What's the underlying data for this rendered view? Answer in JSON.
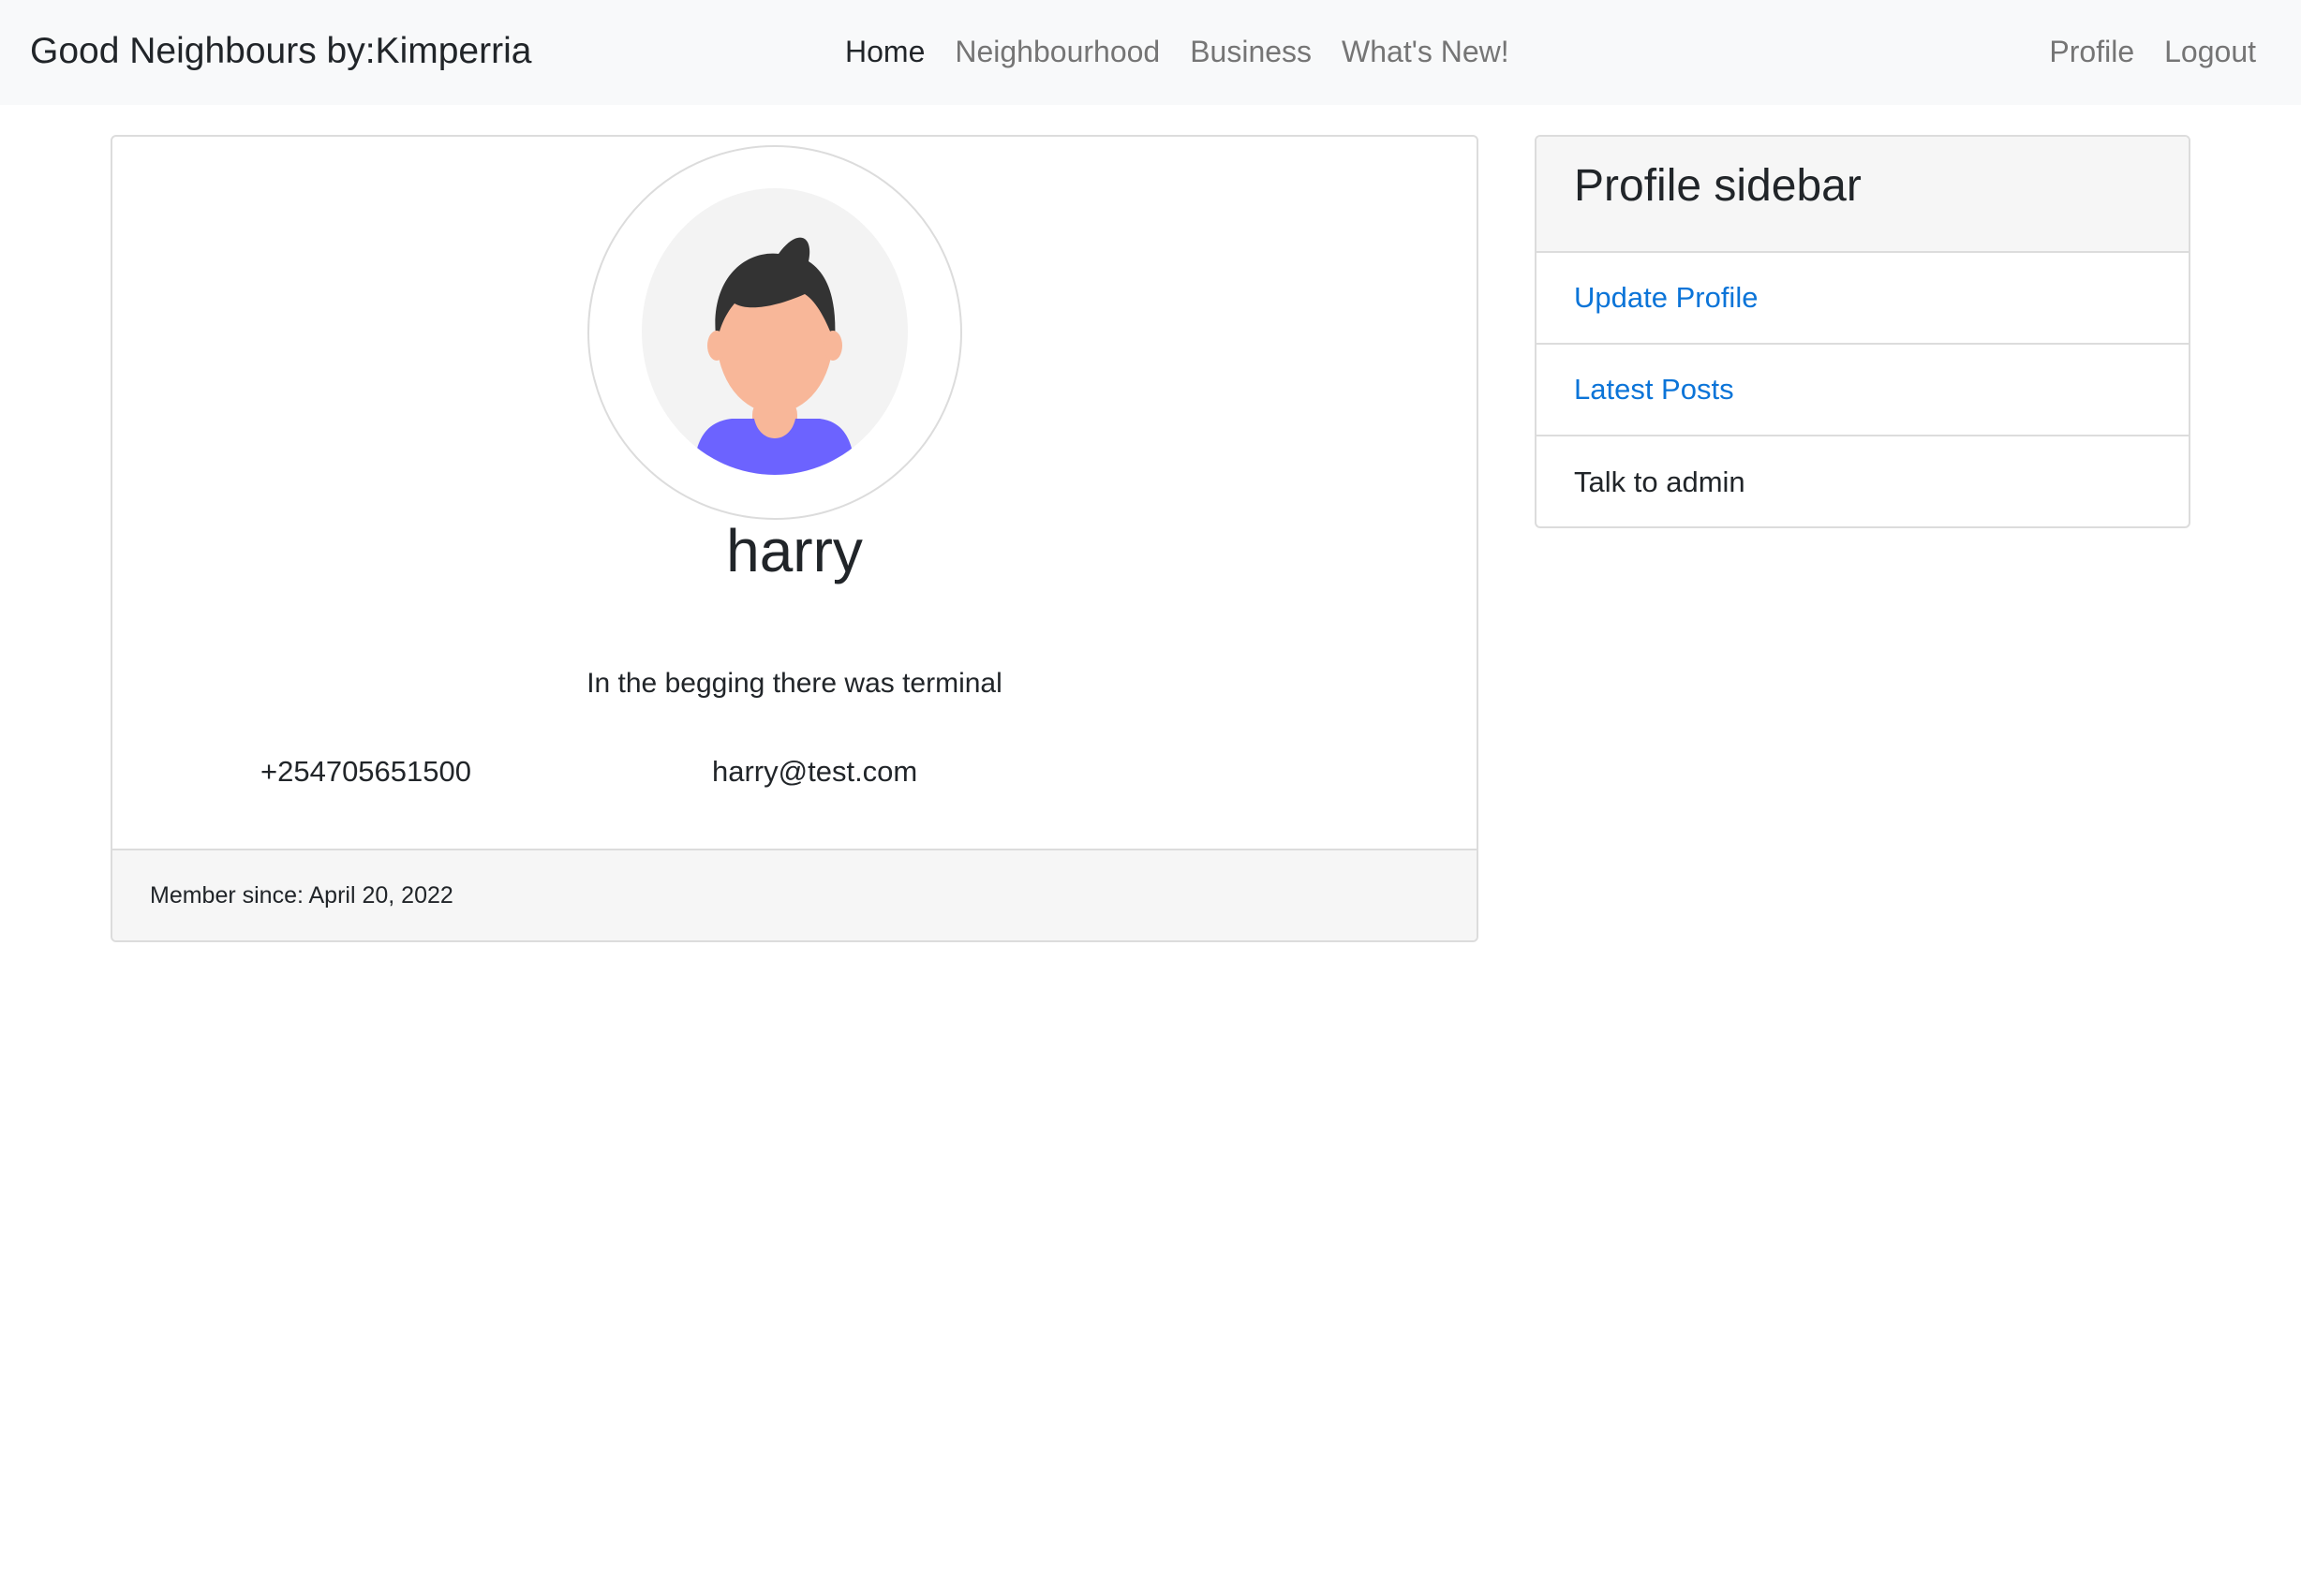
{
  "navbar": {
    "brand": "Good Neighbours by:Kimperria",
    "main_links": [
      {
        "label": "Home",
        "active": true
      },
      {
        "label": "Neighbourhood",
        "active": false
      },
      {
        "label": "Business",
        "active": false
      },
      {
        "label": "What's New!",
        "active": false
      }
    ],
    "right_links": [
      {
        "label": "Profile"
      },
      {
        "label": "Logout"
      }
    ]
  },
  "profile": {
    "avatar_icon": "user-avatar-icon",
    "username": "harry",
    "bio": "In the begging there was terminal",
    "phone": "+254705651500",
    "email": "harry@test.com",
    "member_since": "Member since: April 20, 2022"
  },
  "sidebar": {
    "title": "Profile sidebar",
    "items": [
      {
        "label": "Update Profile",
        "type": "link"
      },
      {
        "label": "Latest Posts",
        "type": "link"
      },
      {
        "label": "Talk to admin",
        "type": "text"
      }
    ]
  },
  "colors": {
    "navbar_bg": "#f8f9fa",
    "link": "#0b74d8",
    "nav_inactive": "#757575",
    "text": "#212529",
    "avatar_shirt": "#6c63ff",
    "avatar_skin": "#f8b799",
    "avatar_hair": "#333333"
  }
}
